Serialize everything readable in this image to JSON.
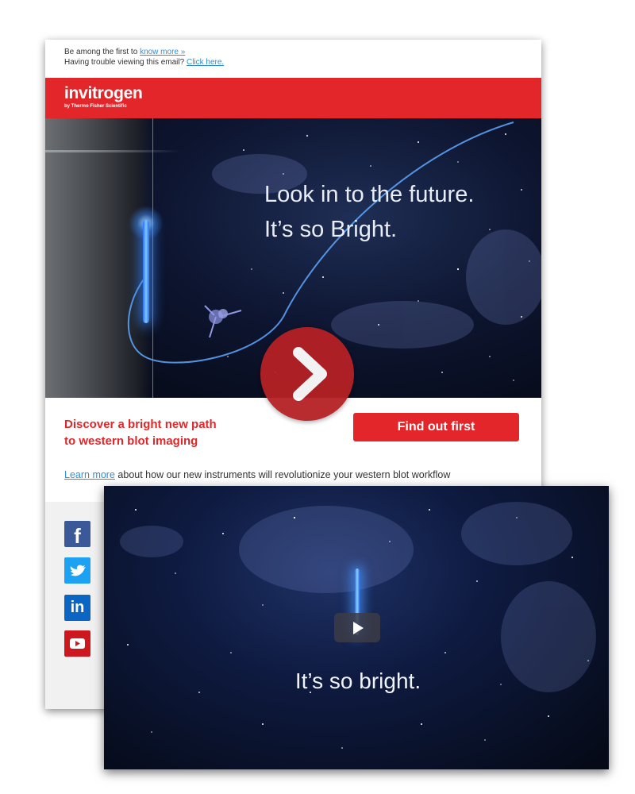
{
  "preheader": {
    "line1_text": "Be among the first to",
    "line1_link": "know more »",
    "line2_text": "Having trouble viewing this email?",
    "line2_link": "Click here."
  },
  "brand": {
    "name": "invitrogen",
    "tagline": "by Thermo Fisher Scientific",
    "color": "#e3262a"
  },
  "hero": {
    "line1": "Look in to the future.",
    "line2": "It’s so Bright."
  },
  "headline": {
    "line1": "Discover a bright new path",
    "line2": "to western blot imaging"
  },
  "cta": {
    "label": "Find out first"
  },
  "learn_more": {
    "link": "Learn more",
    "text": " about how our new instruments will revolutionize your western blot workflow"
  },
  "social": [
    {
      "name": "facebook",
      "icon": "facebook-icon",
      "glyph": "f"
    },
    {
      "name": "twitter",
      "icon": "twitter-icon",
      "glyph": ""
    },
    {
      "name": "linkedin",
      "icon": "linkedin-icon",
      "glyph": "in"
    },
    {
      "name": "youtube",
      "icon": "youtube-icon",
      "glyph": ""
    }
  ],
  "video": {
    "caption": "It’s so bright."
  }
}
